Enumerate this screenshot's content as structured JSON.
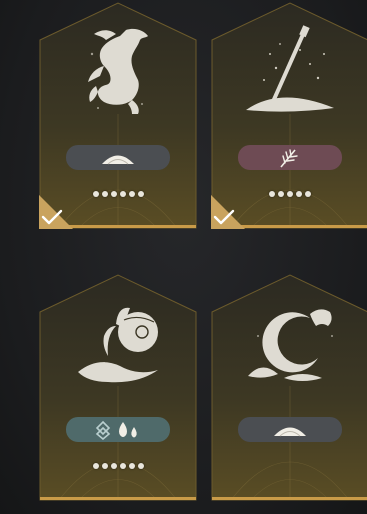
{
  "colors": {
    "card_fill_top": "#2c2a22",
    "card_fill_bottom": "#5a4d24",
    "card_border": "#6b5a2c",
    "card_bottom_edge": "#c99b48",
    "check_corner": "#c9a35e",
    "pill_grey": "#4b4e52",
    "pill_rose": "#6e4b54",
    "pill_teal": "#4f6a6a",
    "dot": "#e9e6dc"
  },
  "cards": [
    {
      "art_icon": "rearing-horse-icon",
      "pill_style": "grey",
      "pill_icons": [
        "sand-pile-icon"
      ],
      "dot_count": 6,
      "completed": true
    },
    {
      "art_icon": "spear-in-sand-icon",
      "pill_style": "rose",
      "pill_icons": [
        "feather-icon"
      ],
      "dot_count": 5,
      "completed": true
    },
    {
      "art_icon": "pouring-urn-icon",
      "pill_style": "teal",
      "pill_icons": [
        "knot-rune-icon",
        "water-drops-icon"
      ],
      "dot_count": 6,
      "completed": false
    },
    {
      "art_icon": "crescent-moon-woman-icon",
      "pill_style": "grey",
      "pill_icons": [
        "sand-pile-icon"
      ],
      "dot_count": 0,
      "completed": false
    }
  ]
}
